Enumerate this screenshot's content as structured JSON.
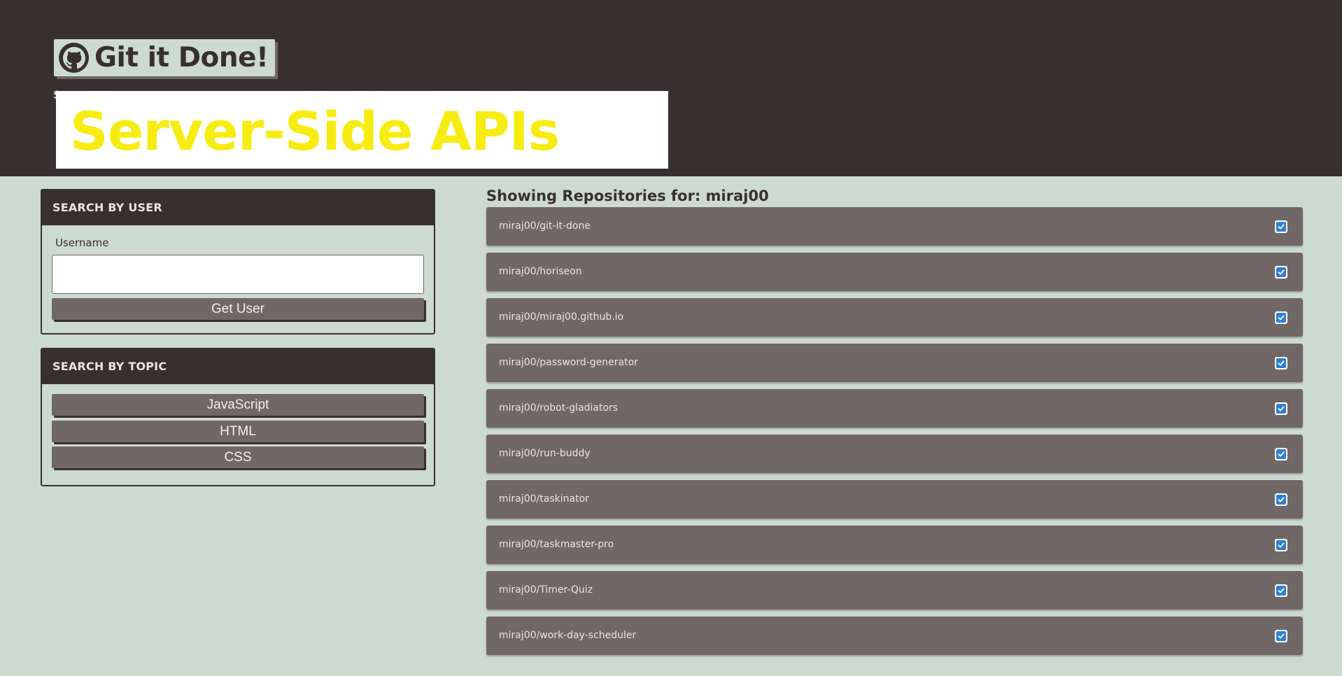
{
  "header": {
    "brand_title": "Git it Done!",
    "brand_icon": "github-octocat-icon",
    "subtitle_peek": "S",
    "banner_text": "Server-Side APIs"
  },
  "search_user": {
    "heading": "SEARCH BY USER",
    "label": "Username",
    "input_value": "",
    "input_placeholder": "",
    "button_label": "Get User"
  },
  "search_topic": {
    "heading": "SEARCH BY TOPIC",
    "topics": [
      "JavaScript",
      "HTML",
      "CSS"
    ]
  },
  "repos": {
    "heading": "Showing Repositories for: miraj00",
    "status_icon": "check-square-icon",
    "items": [
      "miraj00/git-it-done",
      "miraj00/horiseon",
      "miraj00/miraj00.github.io",
      "miraj00/password-generator",
      "miraj00/robot-gladiators",
      "miraj00/run-buddy",
      "miraj00/taskinator",
      "miraj00/taskmaster-pro",
      "miraj00/Timer-Quiz",
      "miraj00/work-day-scheduler"
    ]
  },
  "colors": {
    "header_bg": "#383030",
    "page_bg": "#cddad0",
    "button_bg": "#716766",
    "banner_text": "#f7ec12",
    "status_blue": "#2f7fd6"
  }
}
